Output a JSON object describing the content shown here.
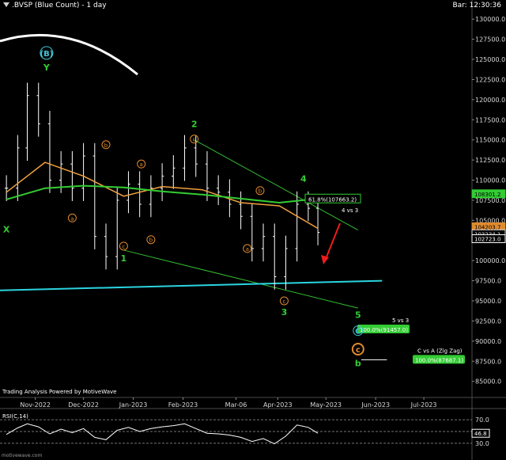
{
  "header": {
    "title": ".BVSP (Blue Count) - 1 day",
    "bar_time": "Bar: 12:30:36"
  },
  "credit": "Trading Analysis Powered by MotiveWave",
  "footer_brand": "motivewave.com",
  "colors": {
    "background": "#000000",
    "price_bars": "#ffffff",
    "ma_short": "#f0a040",
    "ma_long": "#33cc33",
    "trendline": "#33bb33",
    "support": "#2ad4e0",
    "wave_orange": "#e08a2e",
    "wave_green": "#33cc33",
    "wave_cyan": "#3fc6d6",
    "target_box": "#33cc33",
    "arrow": "#ee1c1c"
  },
  "chart_data": [
    {
      "type": "line",
      "subtype": "candlestick",
      "title": ".BVSP (Blue Count) - 1 day",
      "x_tick_labels": [
        "Nov-2022",
        "Dec-2022",
        "Jan-2023",
        "Feb-2023",
        "Mar-06",
        "Apr-2023",
        "May-2023",
        "Jun-2023",
        "Jul-2023"
      ],
      "y_tick_labels": [
        "130000.0",
        "127500.0",
        "125000.0",
        "122500.0",
        "120000.0",
        "117500.0",
        "115000.0",
        "112500.0",
        "110000.0",
        "107500.0",
        "105000.0",
        "102500.0",
        "100000.0",
        "97500.0",
        "95000.0",
        "92500.0",
        "90000.0",
        "87500.0",
        "85000.0"
      ],
      "ylim": [
        83000,
        131000
      ],
      "grid": false,
      "series": [
        {
          "kind": "price",
          "x": [
            "2022-10-14",
            "2022-10-21",
            "2022-10-27",
            "2022-11-03",
            "2022-11-10",
            "2022-11-17",
            "2022-11-24",
            "2022-12-01",
            "2022-12-08",
            "2022-12-15",
            "2022-12-22",
            "2022-12-29",
            "2023-01-05",
            "2023-01-12",
            "2023-01-19",
            "2023-01-26",
            "2023-02-02",
            "2023-02-09",
            "2023-02-16",
            "2023-02-23",
            "2023-03-02",
            "2023-03-09",
            "2023-03-16",
            "2023-03-23",
            "2023-03-30",
            "2023-04-06",
            "2023-04-13",
            "2023-04-20",
            "2023-04-26"
          ],
          "close": [
            109000,
            114000,
            120500,
            117000,
            110000,
            112000,
            109000,
            113000,
            103000,
            100500,
            107500,
            109500,
            107000,
            109000,
            110500,
            111500,
            114000,
            112000,
            109000,
            108500,
            107000,
            105500,
            101500,
            103000,
            98000,
            101500,
            107000,
            106500,
            103500
          ]
        },
        {
          "name": "",
          "kind": "moving-average-short",
          "x": [
            "2022-10-14",
            "2022-11-07",
            "2022-12-01",
            "2022-12-26",
            "2023-01-19",
            "2023-02-13",
            "2023-03-09",
            "2023-04-02",
            "2023-04-26"
          ],
          "values": [
            108500,
            112200,
            110500,
            108000,
            109200,
            108800,
            107200,
            106800,
            104000
          ]
        },
        {
          "name": "",
          "kind": "moving-average-long",
          "x": [
            "2022-10-14",
            "2022-11-07",
            "2022-12-01",
            "2022-12-26",
            "2023-01-19",
            "2023-02-13",
            "2023-03-09",
            "2023-04-02",
            "2023-04-26"
          ],
          "values": [
            107600,
            109000,
            109300,
            109100,
            108600,
            108200,
            107700,
            107200,
            107700
          ]
        }
      ],
      "labels": {
        "fib": "61.8%(107663.2)",
        "fib_value": 107663.2,
        "wave4_note": "4 vs 3",
        "wave5_note": "5 vs 3",
        "wave5_target": "100.0%(91457.0)",
        "wave5_target_value": 91457.0,
        "waveC_note": "C vs A (Zig Zag)",
        "waveC_target": "100.0%(87687.1)",
        "waveC_target_value": 87687.1
      },
      "price_tags": [
        {
          "text": "108301.2",
          "value": 108301.2,
          "color": "#33cc33"
        },
        {
          "text": "104203.7",
          "value": 104203.7,
          "color": "#e08a2e"
        },
        {
          "text": "103234.1",
          "value": 103234.1,
          "color": "#e0e0e0"
        },
        {
          "text": "102723.0",
          "value": 102723.0,
          "color": "#ffffff"
        }
      ],
      "wave_labels": [
        {
          "text": "(B)",
          "date": "2022-11-08",
          "value": 125800,
          "style": "cyan-circle"
        },
        {
          "text": "Y",
          "date": "2022-11-08",
          "value": 124000,
          "style": "green"
        },
        {
          "text": "X",
          "date": "2022-10-14",
          "value": 103900,
          "style": "green"
        },
        {
          "text": "a",
          "date": "2022-11-24",
          "value": 105300,
          "style": "orange-circle"
        },
        {
          "text": "b",
          "date": "2022-12-15",
          "value": 114400,
          "style": "orange-circle"
        },
        {
          "text": "c",
          "date": "2022-12-26",
          "value": 101800,
          "style": "orange-circle"
        },
        {
          "text": "1",
          "date": "2022-12-26",
          "value": 100300,
          "style": "green"
        },
        {
          "text": "a",
          "date": "2023-01-06",
          "value": 112000,
          "style": "orange-circle"
        },
        {
          "text": "b",
          "date": "2023-01-12",
          "value": 102600,
          "style": "orange-circle"
        },
        {
          "text": "c",
          "date": "2023-02-08",
          "value": 115100,
          "style": "orange-circle"
        },
        {
          "text": "2",
          "date": "2023-02-08",
          "value": 117000,
          "style": "green"
        },
        {
          "text": "a",
          "date": "2023-03-13",
          "value": 101500,
          "style": "orange-circle"
        },
        {
          "text": "b",
          "date": "2023-03-21",
          "value": 108700,
          "style": "orange-circle"
        },
        {
          "text": "c",
          "date": "2023-04-05",
          "value": 95000,
          "style": "orange-circle"
        },
        {
          "text": "3",
          "date": "2023-04-05",
          "value": 93600,
          "style": "green"
        },
        {
          "text": "4",
          "date": "2023-04-17",
          "value": 110200,
          "style": "green"
        },
        {
          "text": "5",
          "date": "2023-05-21",
          "value": 93300,
          "style": "green"
        },
        {
          "text": "C",
          "date": "2023-05-21",
          "value": 91300,
          "style": "cyan-circle"
        },
        {
          "text": "c",
          "date": "2023-05-21",
          "value": 89000,
          "style": "orange-circle-filled"
        },
        {
          "text": "b",
          "date": "2023-05-21",
          "value": 87300,
          "style": "green"
        }
      ],
      "trendlines": [
        {
          "kind": "channel-upper",
          "color": "#33bb33",
          "points": [
            {
              "date": "2023-02-08",
              "value": 115000
            },
            {
              "date": "2023-05-21",
              "value": 103800
            }
          ]
        },
        {
          "kind": "channel-lower",
          "color": "#33bb33",
          "points": [
            {
              "date": "2022-12-26",
              "value": 101300
            },
            {
              "date": "2023-05-21",
              "value": 94100
            }
          ]
        },
        {
          "kind": "support",
          "color": "#2ad4e0",
          "points": [
            {
              "date": "2022-10-10",
              "value": 96300
            },
            {
              "date": "2023-06-05",
              "value": 97500
            }
          ]
        },
        {
          "kind": "target-5-vs-3",
          "color": "#ffffff",
          "points": [
            {
              "date": "2023-05-23",
              "value": 91457
            },
            {
              "date": "2023-06-08",
              "value": 91457
            }
          ]
        },
        {
          "kind": "target-c-vs-a",
          "color": "#ffffff",
          "points": [
            {
              "date": "2023-05-23",
              "value": 87687
            },
            {
              "date": "2023-06-08",
              "value": 87687
            }
          ]
        }
      ]
    },
    {
      "type": "line",
      "title": "RSI(C,14)",
      "ylim": [
        15,
        85
      ],
      "y_tick_labels": [
        "70.0",
        "50.0",
        "30.0"
      ],
      "value_tag": "46.8",
      "reference_lines": [
        70,
        50,
        30
      ],
      "x": [
        "2022-10-14",
        "2022-10-21",
        "2022-10-27",
        "2022-11-03",
        "2022-11-10",
        "2022-11-17",
        "2022-11-24",
        "2022-12-01",
        "2022-12-08",
        "2022-12-15",
        "2022-12-22",
        "2022-12-29",
        "2023-01-05",
        "2023-01-12",
        "2023-01-19",
        "2023-01-26",
        "2023-02-02",
        "2023-02-09",
        "2023-02-16",
        "2023-02-23",
        "2023-03-02",
        "2023-03-09",
        "2023-03-16",
        "2023-03-23",
        "2023-03-30",
        "2023-04-06",
        "2023-04-13",
        "2023-04-20",
        "2023-04-26"
      ],
      "values": [
        45,
        56,
        63,
        58,
        46,
        54,
        48,
        55,
        40,
        36,
        52,
        57,
        50,
        55,
        58,
        60,
        63,
        55,
        47,
        46,
        44,
        40,
        33,
        38,
        29,
        42,
        61,
        57,
        47
      ]
    }
  ]
}
